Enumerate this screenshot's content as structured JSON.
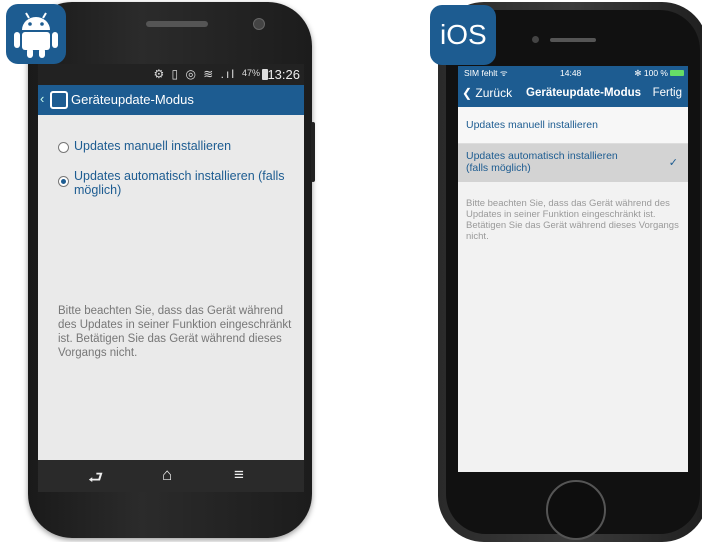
{
  "android": {
    "status": {
      "icons": "⚙ ▯ ◎ ≋ .ıl",
      "battery": "47%",
      "time": "13:26"
    },
    "action_bar": {
      "back": "‹",
      "title": "Geräteupdate-Modus"
    },
    "options": [
      {
        "label": "Updates manuell installieren",
        "selected": false
      },
      {
        "label": "Updates automatisch installieren (falls möglich)",
        "selected": true
      }
    ],
    "note": "Bitte beachten Sie, dass das Gerät während des Updates in seiner Funktion eingeschränkt ist. Betätigen Sie das Gerät während dieses Vorgangs nicht.",
    "navbar": {
      "back": "⮐",
      "home": "⌂",
      "menu": "≡"
    }
  },
  "ios": {
    "badge": "iOS",
    "status": {
      "carrier": "SIM fehlt ᯤ",
      "time": "14:48",
      "battery": "✻ 100 %"
    },
    "nav": {
      "back": "❮ Zurück",
      "title": "Geräteupdate-Modus",
      "done": "Fertig"
    },
    "options": [
      {
        "label": "Updates manuell installieren",
        "selected": false
      },
      {
        "label": "Updates automatisch installieren (falls möglich)",
        "selected": true
      }
    ],
    "check": "✓",
    "note": "Bitte beachten Sie, dass das Gerät während des Updates in seiner Funktion eingeschränkt ist. Betätigen Sie das Gerät während dieses Vorgangs nicht."
  },
  "colors": {
    "brand": "#1d5c91",
    "screen_bg": "#eaeaea"
  },
  "icons": {
    "android_badge": "android-robot-icon"
  }
}
